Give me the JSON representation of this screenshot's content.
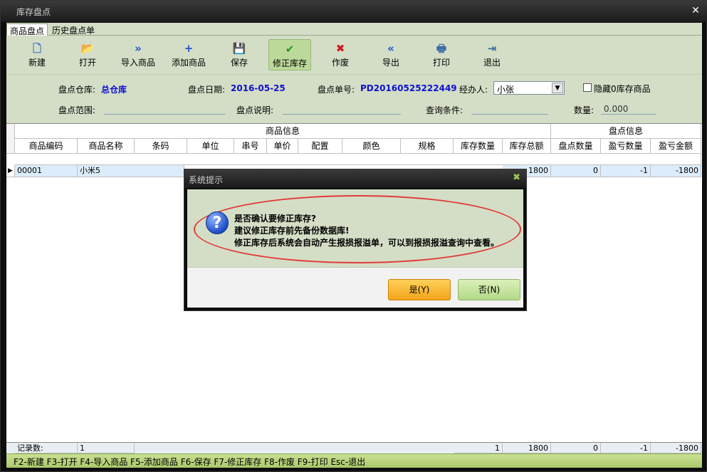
{
  "window": {
    "title": "库存盘点",
    "close_label": "✕"
  },
  "tabs": [
    {
      "label": "商品盘点"
    },
    {
      "label": "历史盘点单"
    }
  ],
  "toolbar": [
    {
      "label": "新建",
      "icon": "new-document-icon",
      "glyph": "🗋",
      "color": "#3b6bc8"
    },
    {
      "label": "打开",
      "icon": "open-folder-icon",
      "glyph": "📂",
      "color": "#d4a020"
    },
    {
      "label": "导入商品",
      "icon": "import-icon",
      "glyph": "»",
      "color": "#1d55c8"
    },
    {
      "label": "添加商品",
      "icon": "add-icon",
      "glyph": "+",
      "color": "#1d55c8"
    },
    {
      "label": "保存",
      "icon": "save-icon",
      "glyph": "💾",
      "color": "#1d55c8"
    },
    {
      "label": "修正库存",
      "icon": "check-icon",
      "glyph": "✔",
      "color": "#1f9a1f"
    },
    {
      "label": "作废",
      "icon": "cancel-icon",
      "glyph": "✖",
      "color": "#d01818"
    },
    {
      "label": "导出",
      "icon": "export-icon",
      "glyph": "«",
      "color": "#1d55c8"
    },
    {
      "label": "打印",
      "icon": "print-icon",
      "glyph": "🖶",
      "color": "#3a6ea8"
    },
    {
      "label": "退出",
      "icon": "exit-icon",
      "glyph": "⇥",
      "color": "#3a6ea8"
    }
  ],
  "form": {
    "warehouse_label": "盘点仓库:",
    "warehouse_value": "总仓库",
    "date_label": "盘点日期:",
    "date_value": "2016-05-25",
    "order_label": "盘点单号:",
    "order_value": "PD20160525222449",
    "handler_label": "经办人:",
    "handler_value": "小张",
    "hide_zero_label": "隐藏0库存商品",
    "scope_label": "盘点范围:",
    "note_label": "盘点说明:",
    "query_label": "查询条件:",
    "qty_label": "数量:",
    "qty_value": "0.000"
  },
  "grid": {
    "group_product": "商品信息",
    "group_count": "盘点信息",
    "columns": [
      "商品编码",
      "商品名称",
      "条码",
      "单位",
      "串号",
      "单价",
      "配置",
      "颜色",
      "规格",
      "库存数量",
      "库存总额",
      "盘点数量",
      "盈亏数量",
      "盈亏金额"
    ],
    "row": {
      "code": "00001",
      "name": "小米5",
      "stock_total": "1800",
      "count_qty": "0",
      "diff_qty": "-1",
      "diff_amount": "-1800"
    },
    "footer": {
      "label": "记录数:",
      "count": "1",
      "stock_qty": "1",
      "stock_total": "1800",
      "count_qty": "0",
      "diff_qty": "-1",
      "diff_amount": "-1800"
    }
  },
  "status_bar": "F2-新建 F3-打开 F4-导入商品 F5-添加商品 F6-保存 F7-修正库存 F8-作废 F9-打印 Esc-退出",
  "dialog": {
    "title": "系统提示",
    "close_label": "✖",
    "line1": "是否确认要修正库存?",
    "line2": "建议修正库存前先备份数据库!",
    "line3": "修正库存后系统会自动产生报损报溢单，可以到报损报溢查询中查看。",
    "yes_label": "是(Y)",
    "no_label": "否(N)"
  }
}
